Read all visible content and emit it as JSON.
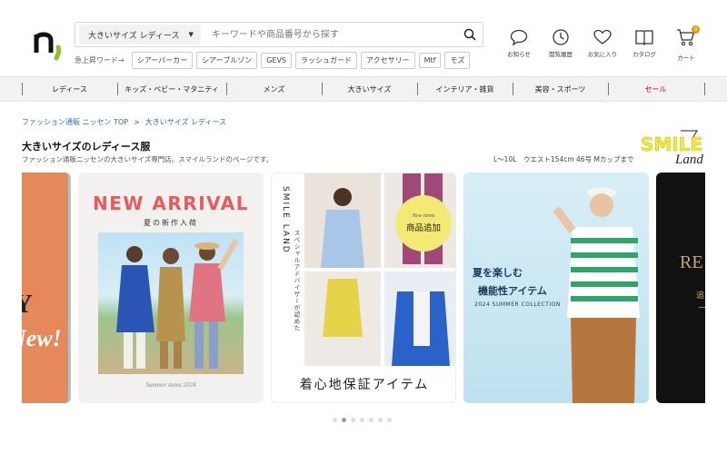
{
  "header": {
    "search": {
      "category": "大きいサイズ レディース",
      "placeholder": "キーワードや商品番号から探す"
    },
    "trend_label": "急上昇ワード→",
    "trend_words": [
      "シアーパーカー",
      "シアーブルゾン",
      "GEVS",
      "ラッシュガード",
      "アクセサリー",
      "Mtf",
      "モズ"
    ],
    "icons": [
      {
        "name": "notification",
        "label": "お知らせ"
      },
      {
        "name": "history",
        "label": "閲覧履歴"
      },
      {
        "name": "favorite",
        "label": "お気に入り"
      },
      {
        "name": "catalog",
        "label": "カタログ"
      },
      {
        "name": "cart",
        "label": "カート",
        "badge": "0"
      }
    ]
  },
  "nav": {
    "items": [
      "レディース",
      "キッズ・ベビー・マタニティ",
      "メンズ",
      "大きいサイズ",
      "インテリア・雑貨",
      "美容・スポーツ",
      "セール"
    ],
    "sale_color": "#d7000f"
  },
  "breadcrumb": {
    "items": [
      "ファッション通販 ニッセン TOP",
      "大きいサイズ レディース"
    ],
    "separator": ">"
  },
  "page": {
    "title": "大きいサイズのレディース服",
    "description": "ファッション通販ニッセンの大きいサイズ専門店。スマイルランドのページです。",
    "size_note": "L～10L　ウエスト154cm 46号 Mカップまで",
    "brand_logo": {
      "main": "SMILE",
      "script": "Land"
    }
  },
  "carousel": {
    "slide1": {
      "big": "AY",
      "script": "New!"
    },
    "slide2": {
      "title": "NEW ARRIVAL",
      "subtitle": "夏の新作入荷",
      "caption": "Summer items 2024"
    },
    "slide3": {
      "vertical_title": "SMILE LAND",
      "vertical_sub": "スペシャルアドバイザーが認めた",
      "bottom": "着心地保証アイテム",
      "badge_en": "New items",
      "badge_jp": "商品追加"
    },
    "slide4": {
      "line1": "夏を楽しむ",
      "line2": "機能性アイテム",
      "line3": "2024 SUMMER COLLECTION"
    },
    "slide5": {
      "big": "RE",
      "line1": "追",
      "line2": "ー"
    },
    "dots": 7,
    "active_dot": 1
  },
  "colors": {
    "accent_link": "#2f6fb2",
    "new_arrival": "#ea5a5a",
    "cart_badge": "#f39800",
    "logo_green": "#8dc21f"
  }
}
